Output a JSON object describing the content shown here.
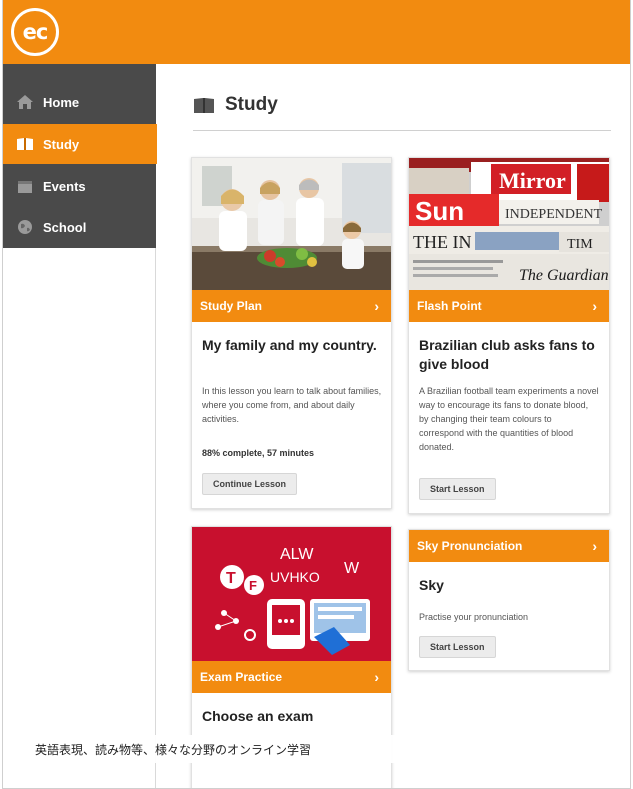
{
  "brand": {
    "logo_text": "ec",
    "accent_color": "#f28b10",
    "sidebar_color": "#4a4a4a"
  },
  "sidebar": {
    "items": [
      {
        "label": "Home",
        "icon": "home-icon",
        "active": false
      },
      {
        "label": "Study",
        "icon": "book-icon",
        "active": true
      },
      {
        "label": "Events",
        "icon": "calendar-icon",
        "active": false
      },
      {
        "label": "School",
        "icon": "globe-icon",
        "active": false
      }
    ]
  },
  "main": {
    "title": "Study",
    "title_icon": "book-icon",
    "cards": [
      {
        "category": "Study Plan",
        "title": "My family and my country.",
        "description": "In this lesson you learn to talk about families, where you come from, and about daily activities.",
        "progress": "88% complete, 57 minutes",
        "button": "Continue Lesson",
        "image": "family-kitchen-photo"
      },
      {
        "category": "Flash Point",
        "title": "Brazilian club asks fans to give blood",
        "description": "A Brazilian football team experiments a novel way to encourage its fans to donate blood, by changing their team colours to correspond with the quantities of blood donated.",
        "button": "Start Lesson",
        "image": "newspapers-photo",
        "image_text": {
          "a": "Sun",
          "b": "Mirror",
          "c": "INDEPENDENT",
          "d": "THE IN",
          "e": "The Guardian",
          "f": "TIM"
        }
      },
      {
        "category": "Sky Pronunciation",
        "title": "Sky",
        "description": "Practise your pronunciation",
        "button": "Start Lesson"
      },
      {
        "category": "Exam Practice",
        "title": "Choose an exam",
        "image": "exam-illustration",
        "image_text": {
          "a": "T",
          "b": "F",
          "c": "ALW",
          "d": "UVHKO",
          "e": "W"
        }
      }
    ]
  },
  "caption": "英語表現、読み物等、様々な分野のオンライン学習"
}
